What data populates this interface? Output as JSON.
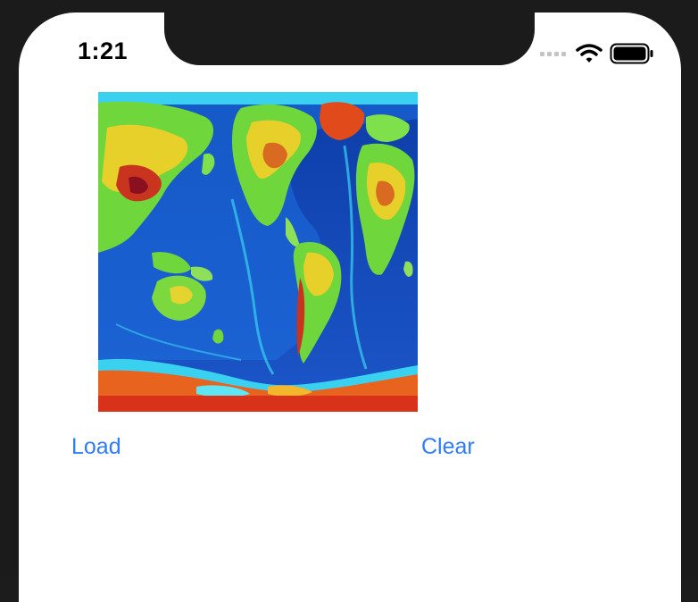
{
  "status_bar": {
    "time": "1:21",
    "icons": [
      "signal-bars-icon",
      "wifi-icon",
      "battery-icon"
    ]
  },
  "image": {
    "description_icon": "world-topography-map-icon"
  },
  "buttons": {
    "load_label": "Load",
    "clear_label": "Clear"
  },
  "colors": {
    "accent": "#2f7cf6",
    "frame": "#1b1b1b",
    "screen": "#ffffff"
  }
}
